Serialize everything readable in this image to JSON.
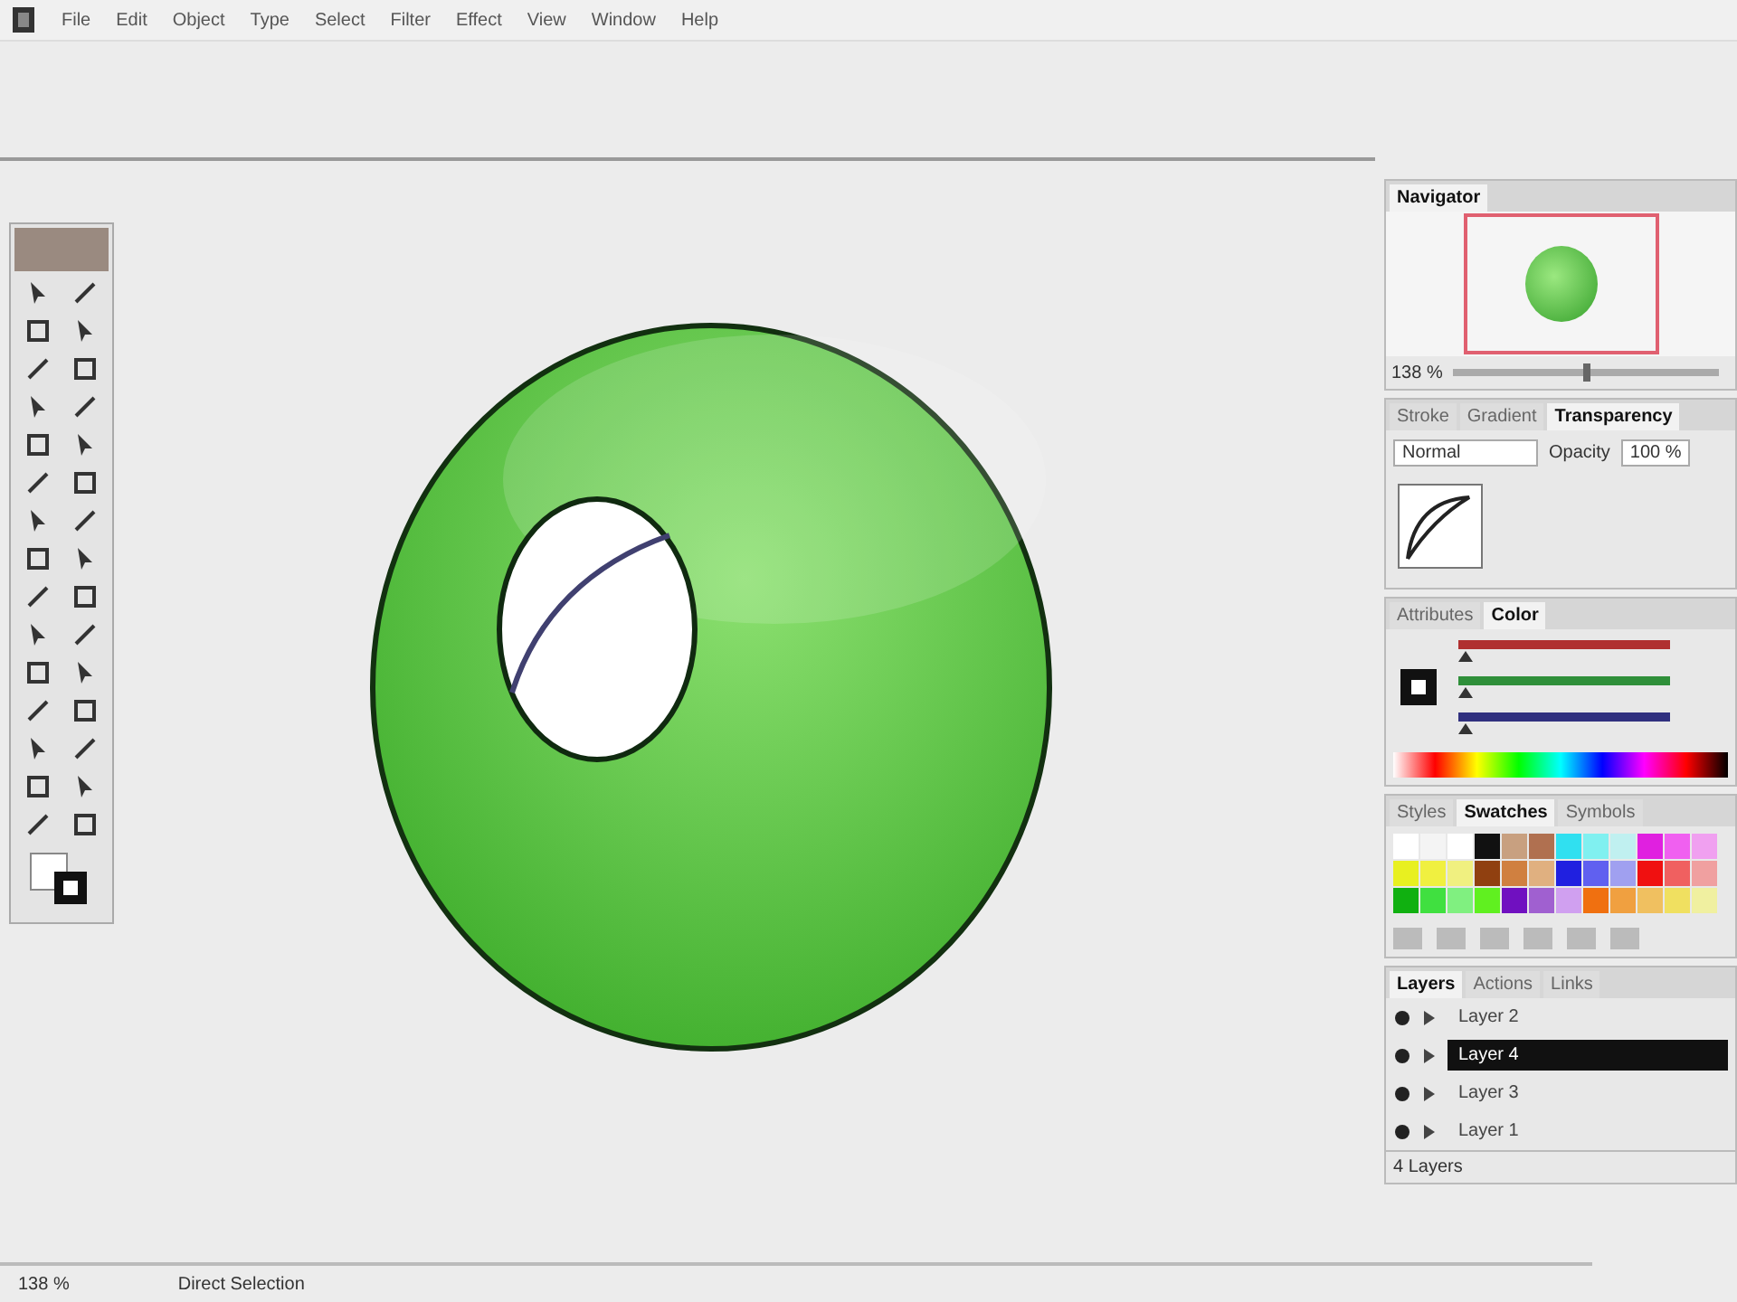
{
  "menu": [
    "File",
    "Edit",
    "Object",
    "Type",
    "Select",
    "Filter",
    "Effect",
    "View",
    "Window",
    "Help"
  ],
  "navigator": {
    "tab": "Navigator",
    "zoom": "138 %",
    "zoom_slider": {
      "level": 0.5
    }
  },
  "transparency": {
    "tabs": [
      {
        "label": "Stroke",
        "selected": false
      },
      {
        "label": "Gradient",
        "selected": false
      },
      {
        "label": "Transparency",
        "selected": true
      }
    ],
    "blend_mode": "Normal",
    "opacity_label": "Opacity",
    "opacity": "100 %"
  },
  "color": {
    "tabs": [
      {
        "label": "Attributes",
        "selected": false
      },
      {
        "label": "Color",
        "selected": true
      }
    ],
    "channels": [
      {
        "level": 0,
        "color": "#b03030"
      },
      {
        "level": 0,
        "color": "#2f8f3a"
      },
      {
        "level": 0,
        "color": "#30307f"
      }
    ]
  },
  "swatches": {
    "tabs": [
      {
        "label": "Styles",
        "selected": false
      },
      {
        "label": "Swatches",
        "selected": true
      },
      {
        "label": "Symbols",
        "selected": false
      }
    ],
    "items": [
      {
        "color": "#ffffff"
      },
      {
        "color": "#f4f4f4"
      },
      {
        "color": "#ffffff"
      },
      {
        "color": "#111111"
      },
      {
        "color": "#c8a080"
      },
      {
        "color": "#b07050"
      },
      {
        "color": "#30e0f0"
      },
      {
        "color": "#80f0f0"
      },
      {
        "color": "#c0f0f0"
      },
      {
        "color": "#e020e0"
      },
      {
        "color": "#f060f0"
      },
      {
        "color": "#f0a0f0"
      },
      {
        "color": "#e8f020"
      },
      {
        "color": "#f0f040"
      },
      {
        "color": "#f0f080"
      },
      {
        "color": "#904010"
      },
      {
        "color": "#d08040"
      },
      {
        "color": "#e0b080"
      },
      {
        "color": "#2020e0"
      },
      {
        "color": "#6060f0"
      },
      {
        "color": "#a0a0f0"
      },
      {
        "color": "#f01010"
      },
      {
        "color": "#f06060"
      },
      {
        "color": "#f0a0a0"
      },
      {
        "color": "#10b010"
      },
      {
        "color": "#40e040"
      },
      {
        "color": "#80f080"
      },
      {
        "color": "#60f020"
      },
      {
        "color": "#7010c0"
      },
      {
        "color": "#a060d0"
      },
      {
        "color": "#d0a0f0"
      },
      {
        "color": "#f07010"
      },
      {
        "color": "#f0a040"
      },
      {
        "color": "#f0c060"
      },
      {
        "color": "#f0e060"
      },
      {
        "color": "#f0f0a0"
      }
    ]
  },
  "layers": {
    "tabs": [
      {
        "label": "Layers",
        "selected": true
      },
      {
        "label": "Actions",
        "selected": false
      },
      {
        "label": "Links",
        "selected": false
      }
    ],
    "items": [
      {
        "name": "Layer 2",
        "selected": false
      },
      {
        "name": "Layer 4",
        "selected": true
      },
      {
        "name": "Layer 3",
        "selected": false
      },
      {
        "name": "Layer 1",
        "selected": false
      }
    ],
    "count": "4 Layers"
  },
  "status_bar": {
    "zoom": "138 %",
    "tool": "Direct Selection"
  }
}
